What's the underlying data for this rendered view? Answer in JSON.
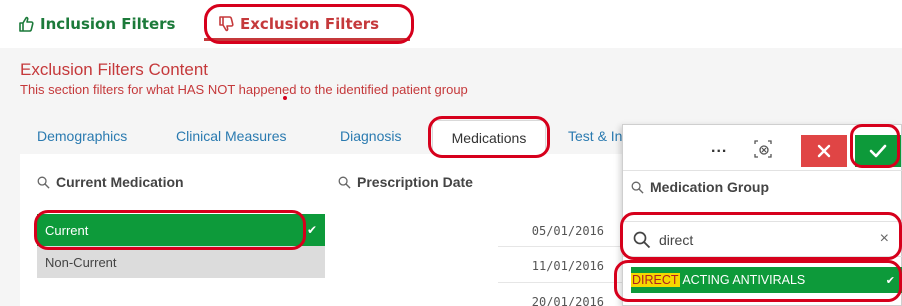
{
  "filter_tabs": {
    "inclusion": "Inclusion Filters",
    "exclusion": "Exclusion Filters",
    "active": "exclusion"
  },
  "content": {
    "title": "Exclusion Filters Content",
    "subtitle": "This section filters for what HAS NOT happened to the identified patient group"
  },
  "sub_tabs": {
    "demographics": "Demographics",
    "clinical_measures": "Clinical Measures",
    "diagnosis": "Diagnosis",
    "medications": "Medications",
    "tests_partial": "Test & In",
    "active": "Medications"
  },
  "current_medication": {
    "header": "Current Medication",
    "items": [
      "Current",
      "Non-Current"
    ],
    "selected": "Current"
  },
  "prescription_date": {
    "header": "Prescription Date",
    "dates": [
      "05/01/2016",
      "11/01/2016",
      "20/01/2016"
    ]
  },
  "popup": {
    "menu_label": "...",
    "header": "Medication Group",
    "search_value": "direct",
    "result_highlight": "DIRECT",
    "result_rest": " ACTING ANTIVIRALS",
    "clear_symbol": "×"
  },
  "colors": {
    "brand_green": "#0d9a3a",
    "brand_red": "#c5393b",
    "link_blue": "#2a7ab0",
    "highlight_yellow": "#f5d800"
  }
}
